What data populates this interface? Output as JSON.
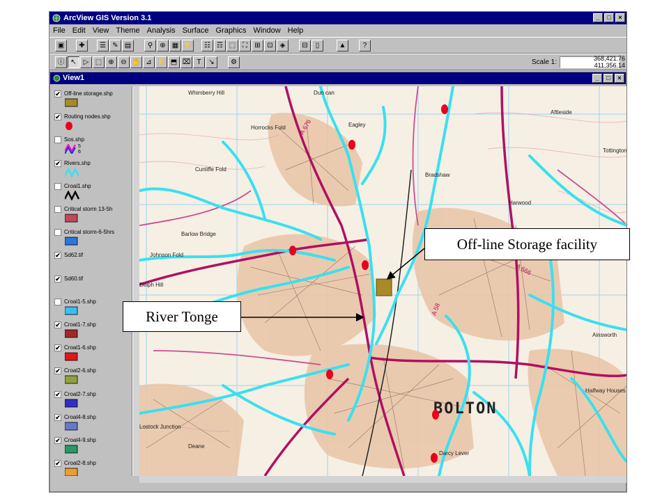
{
  "app": {
    "title": "ArcView GIS Version 3.1",
    "title_buttons": [
      "_",
      "□",
      "×"
    ]
  },
  "menu": [
    "File",
    "Edit",
    "View",
    "Theme",
    "Analysis",
    "Surface",
    "Graphics",
    "Window",
    "Help"
  ],
  "toolbar": {
    "scale_label": "Scale 1:",
    "scale_value": "",
    "coord_x": "368,421.76",
    "coord_y": "411,356.14"
  },
  "view": {
    "title": "View1"
  },
  "layers": [
    {
      "name": "Off-line storage.shp",
      "checked": true,
      "symbol": "box",
      "color": "#a88a28"
    },
    {
      "name": "Routing nodes.shp",
      "checked": true,
      "symbol": "dot",
      "color": "#e8001c"
    },
    {
      "name": "Sos.shp",
      "checked": false,
      "symbol": "wave2",
      "sub": [
        "5",
        "6"
      ]
    },
    {
      "name": "Rivers.shp",
      "checked": true,
      "symbol": "wave",
      "color": "#39e0f0"
    },
    {
      "name": "Croal1.shp",
      "checked": false,
      "symbol": "wave",
      "color": "#000000"
    },
    {
      "name": "Critical storm 13-5h",
      "checked": false,
      "symbol": "box",
      "color": "#c04858"
    },
    {
      "name": "Critical storm-6-5hrs",
      "checked": false,
      "symbol": "box",
      "color": "#2a78d8"
    },
    {
      "name": "Sd62.tif",
      "checked": true,
      "symbol": "none"
    },
    {
      "name": "Sd60.tif",
      "checked": true,
      "symbol": "none"
    },
    {
      "name": "Croal1-5.shp",
      "checked": false,
      "symbol": "box",
      "color": "#38c0f0"
    },
    {
      "name": "Croal1-7.shp",
      "checked": true,
      "symbol": "box",
      "color": "#a02828"
    },
    {
      "name": "Croal1-6.shp",
      "checked": true,
      "symbol": "box",
      "color": "#e01818"
    },
    {
      "name": "Croal2-6.shp",
      "checked": true,
      "symbol": "box",
      "color": "#90a040"
    },
    {
      "name": "Croal2-7.shp",
      "checked": true,
      "symbol": "box",
      "color": "#3030c0"
    },
    {
      "name": "Croal4-8.shp",
      "checked": true,
      "symbol": "box",
      "color": "#6878c8"
    },
    {
      "name": "Croal4-9.shp",
      "checked": true,
      "symbol": "box",
      "color": "#289868"
    },
    {
      "name": "Croal2-8.shp",
      "checked": true,
      "symbol": "box",
      "color": "#e8a030"
    }
  ],
  "map": {
    "town_label": "BOLTON",
    "place_labels": [
      "Whimberry Hill",
      "Dun can",
      "Eagley",
      "Horrocks Fold",
      "Cunliffe Fold",
      "Barlow Bridge",
      "Bradshaw",
      "Aftleside",
      "Tottington",
      "Harwood",
      "Ainsworth",
      "Halfway Houses",
      "Lostock Junction",
      "Deane",
      "Darcy Lever",
      "Delph Hill",
      "Johnson Fold"
    ],
    "road_labels": [
      "A 676",
      "A 58",
      "A 666"
    ],
    "node_color": "#e8001c",
    "river_color": "#39e0f0",
    "storage_color": "#a88a28"
  },
  "annotations": {
    "storage_label": "Off-line Storage facility",
    "river_label": "River Tonge"
  }
}
